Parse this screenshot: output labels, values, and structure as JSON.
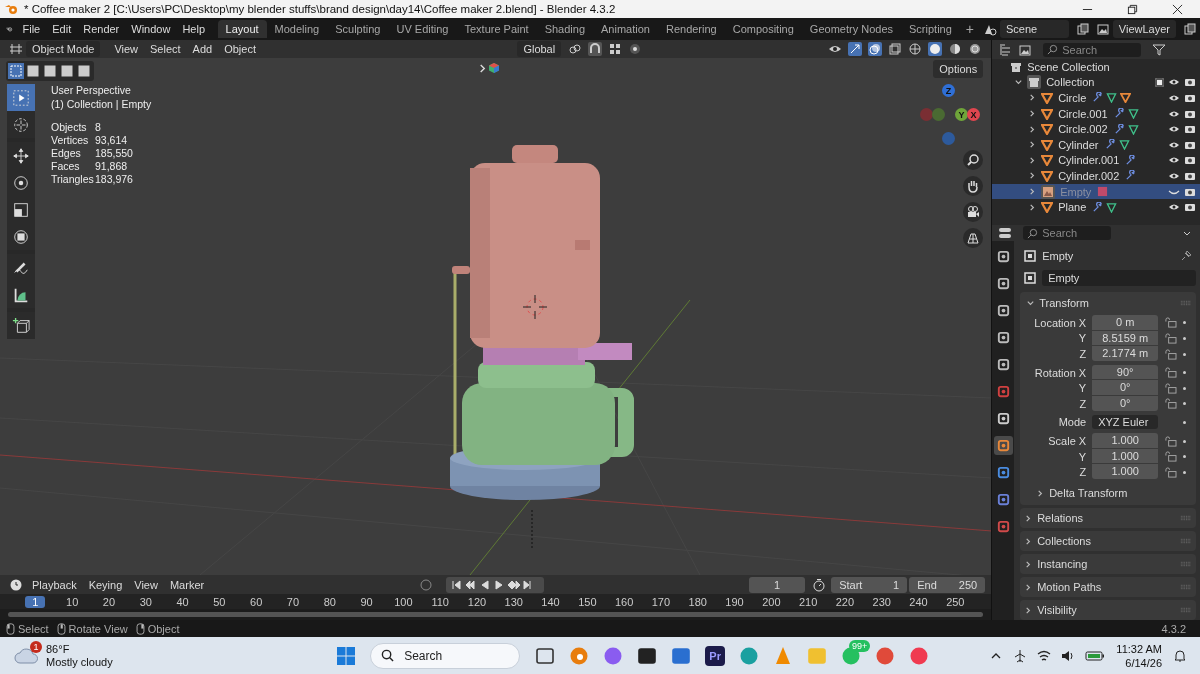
{
  "window": {
    "title": "* Coffee maker 2 [C:\\Users\\PC\\Desktop\\my blender stuffs\\brand design\\day14\\Coffee maker 2.blend] - Blender 4.3.2"
  },
  "menu": [
    "File",
    "Edit",
    "Render",
    "Window",
    "Help"
  ],
  "workspaces": [
    {
      "label": "Layout",
      "selected": true
    },
    {
      "label": "Modeling",
      "selected": false
    },
    {
      "label": "Sculpting",
      "selected": false
    },
    {
      "label": "UV Editing",
      "selected": false
    },
    {
      "label": "Texture Paint",
      "selected": false
    },
    {
      "label": "Shading",
      "selected": false
    },
    {
      "label": "Animation",
      "selected": false
    },
    {
      "label": "Rendering",
      "selected": false
    },
    {
      "label": "Compositing",
      "selected": false
    },
    {
      "label": "Geometry Nodes",
      "selected": false
    },
    {
      "label": "Scripting",
      "selected": false
    }
  ],
  "add_workspace": "+",
  "scene": {
    "name": "Scene"
  },
  "view_layer": {
    "name": "ViewLayer"
  },
  "viewport_header": {
    "mode": "Object Mode",
    "menus": [
      "View",
      "Select",
      "Add",
      "Object"
    ],
    "orientation": "Global"
  },
  "viewport": {
    "options": "Options",
    "view_name": "User Perspective",
    "context": "(1) Collection | Empty",
    "stats": [
      {
        "label": "Objects",
        "value": "8"
      },
      {
        "label": "Vertices",
        "value": "93,614"
      },
      {
        "label": "Edges",
        "value": "185,550"
      },
      {
        "label": "Faces",
        "value": "91,868"
      },
      {
        "label": "Triangles",
        "value": "183,976"
      }
    ],
    "select_modes": [
      {
        "selected": true
      },
      {
        "selected": false
      },
      {
        "selected": false
      },
      {
        "selected": false
      },
      {
        "selected": false
      }
    ],
    "tools": [
      {
        "kind": "select",
        "selected": true
      },
      {
        "kind": "cursor",
        "selected": false
      },
      {
        "kind": "move",
        "selected": false
      },
      {
        "kind": "rotate",
        "selected": false
      },
      {
        "kind": "scale",
        "selected": false
      },
      {
        "kind": "transform",
        "selected": false
      },
      {
        "kind": "annotate",
        "selected": false
      },
      {
        "kind": "measure",
        "selected": false
      },
      {
        "kind": "add-cube",
        "selected": false
      }
    ],
    "gizmo_axes": [
      {
        "label": "Z",
        "color": "#2f6fd6"
      },
      {
        "label": "Y",
        "color": "#6fa53a"
      },
      {
        "label": "X",
        "color": "#e0464f"
      }
    ]
  },
  "outliner": {
    "search_placeholder": "Search",
    "root": "Scene Collection",
    "collection": {
      "name": "Collection",
      "expanded": true,
      "checked": true,
      "children": [
        {
          "name": "Circle",
          "kind": "mesh",
          "selected": false,
          "visible": true,
          "badges": [
            {
              "kind": "modifier"
            },
            {
              "kind": "mesh"
            },
            {
              "kind": "material"
            }
          ]
        },
        {
          "name": "Circle.001",
          "kind": "mesh",
          "selected": false,
          "visible": true,
          "badges": [
            {
              "kind": "modifier"
            },
            {
              "kind": "mesh"
            }
          ]
        },
        {
          "name": "Circle.002",
          "kind": "mesh",
          "selected": false,
          "visible": true,
          "badges": [
            {
              "kind": "modifier"
            },
            {
              "kind": "mesh"
            }
          ]
        },
        {
          "name": "Cylinder",
          "kind": "mesh",
          "selected": false,
          "visible": true,
          "badges": [
            {
              "kind": "modifier"
            },
            {
              "kind": "mesh"
            }
          ]
        },
        {
          "name": "Cylinder.001",
          "kind": "mesh",
          "selected": false,
          "visible": true,
          "badges": [
            {
              "kind": "modifier"
            }
          ]
        },
        {
          "name": "Cylinder.002",
          "kind": "mesh",
          "selected": false,
          "visible": true,
          "badges": [
            {
              "kind": "modifier"
            }
          ]
        },
        {
          "name": "Empty",
          "kind": "empty",
          "selected": true,
          "visible": false,
          "badges": [
            {
              "kind": "image"
            }
          ]
        },
        {
          "name": "Plane",
          "kind": "mesh",
          "selected": false,
          "visible": true,
          "badges": [
            {
              "kind": "modifier"
            },
            {
              "kind": "mesh"
            }
          ]
        }
      ]
    }
  },
  "properties": {
    "search_placeholder": "Search",
    "tabs": [
      {
        "kind": "tool",
        "selected": false
      },
      {
        "kind": "render",
        "selected": false
      },
      {
        "kind": "output",
        "selected": false
      },
      {
        "kind": "view-layer",
        "selected": false
      },
      {
        "kind": "scene",
        "selected": false
      },
      {
        "kind": "world",
        "selected": false
      },
      {
        "kind": "collection",
        "selected": false
      },
      {
        "kind": "object",
        "selected": true
      },
      {
        "kind": "physics",
        "selected": false
      },
      {
        "kind": "constraints",
        "selected": false
      },
      {
        "kind": "data",
        "selected": false
      }
    ],
    "object_name": "Empty",
    "name_field": "Empty",
    "transform": {
      "title": "Transform",
      "expanded": true,
      "groups": [
        [
          {
            "label": "Location X",
            "value": "0 m",
            "kind": "number"
          },
          {
            "label": "Y",
            "value": "8.5159 m",
            "kind": "number"
          },
          {
            "label": "Z",
            "value": "2.1774 m",
            "kind": "number"
          }
        ],
        [
          {
            "label": "Rotation X",
            "value": "90°",
            "kind": "number"
          },
          {
            "label": "Y",
            "value": "0°",
            "kind": "number"
          },
          {
            "label": "Z",
            "value": "0°",
            "kind": "number"
          }
        ],
        [
          {
            "label": "Mode",
            "value": "XYZ Euler",
            "kind": "dropdown"
          }
        ],
        [
          {
            "label": "Scale X",
            "value": "1.000",
            "kind": "number"
          },
          {
            "label": "Y",
            "value": "1.000",
            "kind": "number"
          },
          {
            "label": "Z",
            "value": "1.000",
            "kind": "number"
          }
        ]
      ],
      "subpanel": "Delta Transform"
    },
    "panels": [
      "Relations",
      "Collections",
      "Instancing",
      "Motion Paths",
      "Visibility"
    ]
  },
  "timeline": {
    "menus": [
      "Playback",
      "Keying",
      "View",
      "Marker"
    ],
    "current_frame": "1",
    "start_label": "Start",
    "start": "1",
    "end_label": "End",
    "end": "250",
    "ticks": [
      {
        "label": "1",
        "selected": true
      },
      {
        "label": "10",
        "selected": false
      },
      {
        "label": "20",
        "selected": false
      },
      {
        "label": "30",
        "selected": false
      },
      {
        "label": "40",
        "selected": false
      },
      {
        "label": "50",
        "selected": false
      },
      {
        "label": "60",
        "selected": false
      },
      {
        "label": "70",
        "selected": false
      },
      {
        "label": "80",
        "selected": false
      },
      {
        "label": "90",
        "selected": false
      },
      {
        "label": "100",
        "selected": false
      },
      {
        "label": "110",
        "selected": false
      },
      {
        "label": "120",
        "selected": false
      },
      {
        "label": "130",
        "selected": false
      },
      {
        "label": "140",
        "selected": false
      },
      {
        "label": "150",
        "selected": false
      },
      {
        "label": "160",
        "selected": false
      },
      {
        "label": "170",
        "selected": false
      },
      {
        "label": "180",
        "selected": false
      },
      {
        "label": "190",
        "selected": false
      },
      {
        "label": "200",
        "selected": false
      },
      {
        "label": "210",
        "selected": false
      },
      {
        "label": "220",
        "selected": false
      },
      {
        "label": "230",
        "selected": false
      },
      {
        "label": "240",
        "selected": false
      },
      {
        "label": "250",
        "selected": false
      }
    ]
  },
  "status_bar": {
    "hints": [
      "Select",
      "Rotate View",
      "Object"
    ],
    "version": "4.3.2"
  },
  "taskbar": {
    "weather": {
      "temperature": "86°F",
      "condition": "Mostly cloudy",
      "alert": "1"
    },
    "search_placeholder": "Search",
    "apps": [
      {
        "kind": "task-view"
      },
      {
        "kind": "blender"
      },
      {
        "kind": "copilot"
      },
      {
        "kind": "capcut"
      },
      {
        "kind": "store"
      },
      {
        "kind": "premiere",
        "label": "Pr"
      },
      {
        "kind": "edge"
      },
      {
        "kind": "vlc"
      },
      {
        "kind": "files"
      },
      {
        "kind": "whatsapp",
        "badge": "99+"
      },
      {
        "kind": "chrome"
      },
      {
        "kind": "music"
      }
    ],
    "time": "11:32 AM",
    "date": "6/14/26"
  }
}
